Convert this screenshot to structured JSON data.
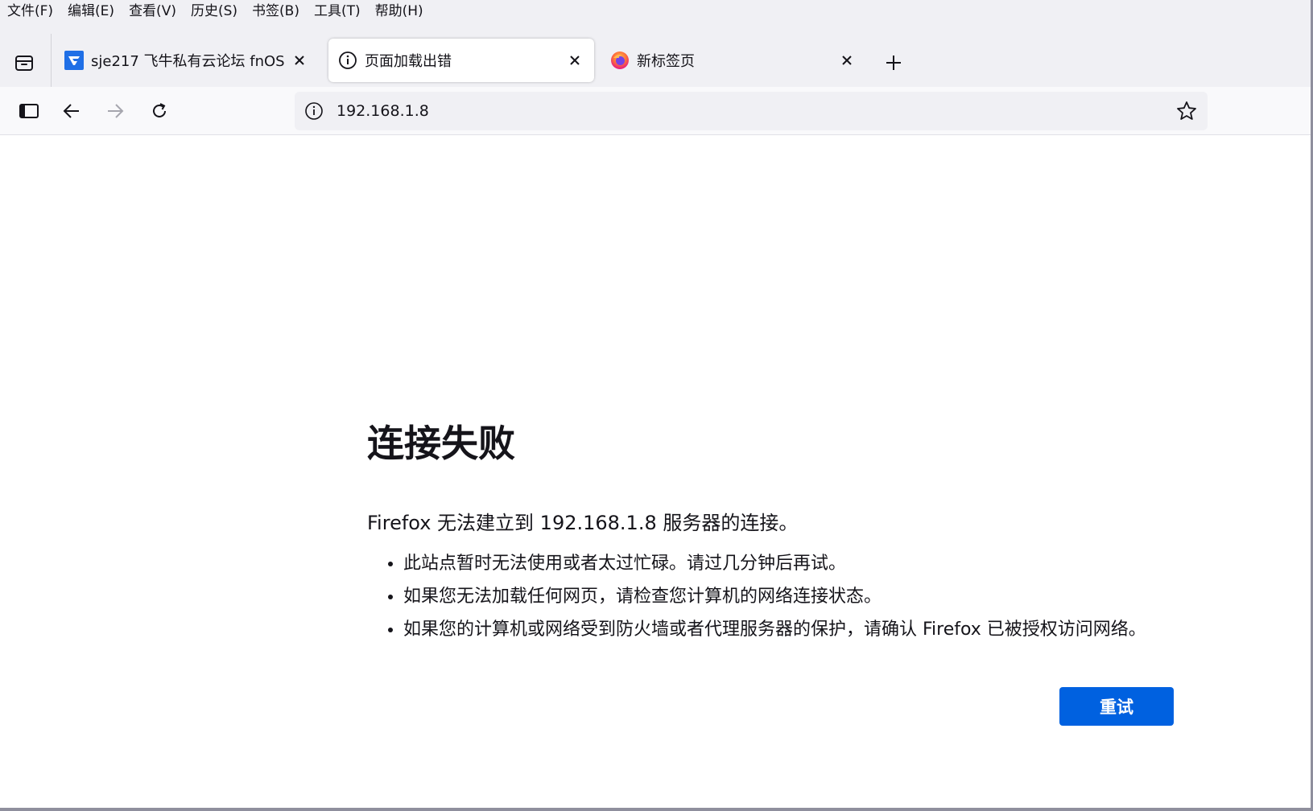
{
  "menubar": {
    "items": [
      "文件(F)",
      "编辑(E)",
      "查看(V)",
      "历史(S)",
      "书签(B)",
      "工具(T)",
      "帮助(H)"
    ]
  },
  "tabs": [
    {
      "title": "sje217 飞牛私有云论坛 fnOS",
      "icon": "fnos-site-icon",
      "active": false
    },
    {
      "title": "页面加载出错",
      "icon": "info-icon",
      "active": true
    },
    {
      "title": "新标签页",
      "icon": "firefox-icon",
      "active": false
    }
  ],
  "navbar": {
    "url": "192.168.1.8"
  },
  "error": {
    "title": "连接失败",
    "description": "Firefox 无法建立到 192.168.1.8 服务器的连接。",
    "bullets": [
      "此站点暂时无法使用或者太过忙碌。请过几分钟后再试。",
      "如果您无法加载任何网页，请检查您计算机的网络连接状态。",
      "如果您的计算机或网络受到防火墙或者代理服务器的保护，请确认 Firefox 已被授权访问网络。"
    ],
    "retry_label": "重试"
  },
  "colors": {
    "accent": "#0061e0",
    "chrome_bg": "#f0f0f4",
    "toolbar_bg": "#f9f9fb"
  }
}
